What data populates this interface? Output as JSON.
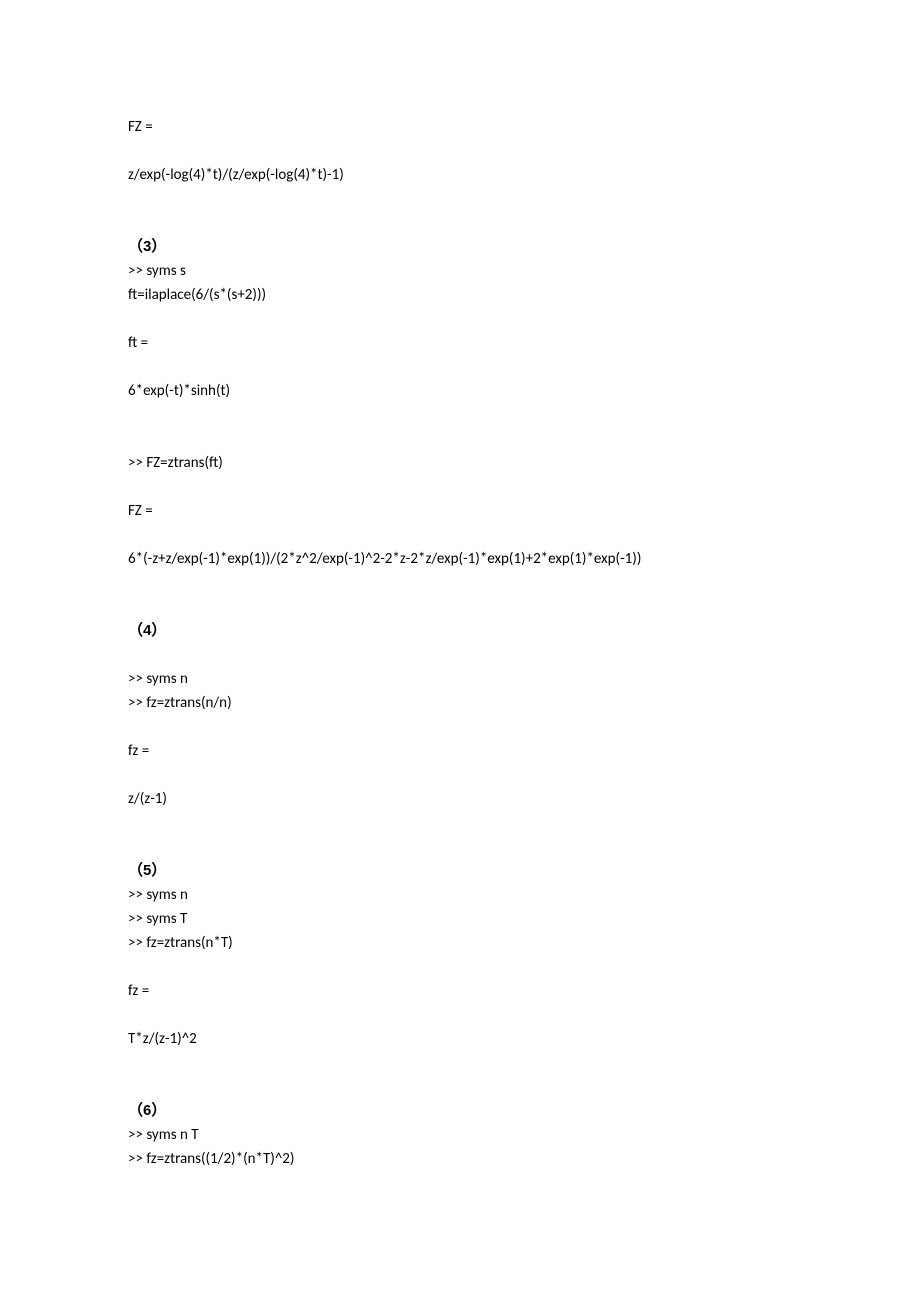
{
  "lines": [
    {
      "text": "FZ =",
      "kind": "text"
    },
    {
      "text": "",
      "kind": "blank"
    },
    {
      "text": "z/exp(-log(4)*t)/(z/exp(-log(4)*t)-1)",
      "kind": "text"
    },
    {
      "text": "",
      "kind": "blank"
    },
    {
      "text": "",
      "kind": "blank"
    },
    {
      "text": "（3）",
      "kind": "section"
    },
    {
      "text": ">> syms s",
      "kind": "text"
    },
    {
      "text": "ft=ilaplace(6/(s*(s+2)))",
      "kind": "text"
    },
    {
      "text": "",
      "kind": "blank"
    },
    {
      "text": "ft =",
      "kind": "text"
    },
    {
      "text": "",
      "kind": "blank"
    },
    {
      "text": "6*exp(-t)*sinh(t)",
      "kind": "text"
    },
    {
      "text": "",
      "kind": "blank"
    },
    {
      "text": "",
      "kind": "blank"
    },
    {
      "text": ">> FZ=ztrans(ft)",
      "kind": "text"
    },
    {
      "text": "",
      "kind": "blank"
    },
    {
      "text": "FZ =",
      "kind": "text"
    },
    {
      "text": "",
      "kind": "blank"
    },
    {
      "text": "6*(-z+z/exp(-1)*exp(1))/(2*z^2/exp(-1)^2-2*z-2*z/exp(-1)*exp(1)+2*exp(1)*exp(-1))",
      "kind": "text"
    },
    {
      "text": "",
      "kind": "blank"
    },
    {
      "text": "",
      "kind": "blank"
    },
    {
      "text": "（4）",
      "kind": "section"
    },
    {
      "text": "",
      "kind": "blank"
    },
    {
      "text": ">> syms n",
      "kind": "text"
    },
    {
      "text": ">> fz=ztrans(n/n)",
      "kind": "text"
    },
    {
      "text": "",
      "kind": "blank"
    },
    {
      "text": "fz =",
      "kind": "text"
    },
    {
      "text": "",
      "kind": "blank"
    },
    {
      "text": "z/(z-1)",
      "kind": "text"
    },
    {
      "text": "",
      "kind": "blank"
    },
    {
      "text": "",
      "kind": "blank"
    },
    {
      "text": "（5）",
      "kind": "section"
    },
    {
      "text": ">> syms n",
      "kind": "text"
    },
    {
      "text": ">> syms T",
      "kind": "text"
    },
    {
      "text": ">> fz=ztrans(n*T)",
      "kind": "text"
    },
    {
      "text": "",
      "kind": "blank"
    },
    {
      "text": "fz =",
      "kind": "text"
    },
    {
      "text": "",
      "kind": "blank"
    },
    {
      "text": "T*z/(z-1)^2",
      "kind": "text"
    },
    {
      "text": "",
      "kind": "blank"
    },
    {
      "text": "",
      "kind": "blank"
    },
    {
      "text": "（6）",
      "kind": "section"
    },
    {
      "text": ">> syms n T",
      "kind": "text"
    },
    {
      "text": ">> fz=ztrans((1/2)*(n*T)^2)",
      "kind": "text"
    }
  ]
}
